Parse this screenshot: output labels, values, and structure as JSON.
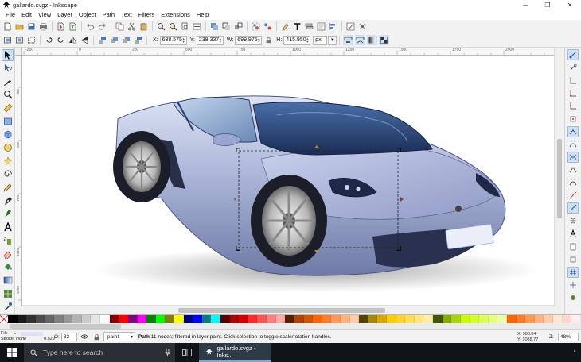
{
  "window": {
    "title": "gallardo.svgz - Inkscape"
  },
  "window_buttons": [
    "─",
    "❐",
    "✕"
  ],
  "menu": [
    "File",
    "Edit",
    "View",
    "Layer",
    "Object",
    "Path",
    "Text",
    "Filters",
    "Extensions",
    "Help"
  ],
  "select_toolbar": {
    "x_label": "X:",
    "x_value": "638.575",
    "y_label": "Y:",
    "y_value": "239.337",
    "w_label": "W:",
    "w_value": "699.975",
    "h_label": "H:",
    "h_value": "415.950",
    "unit": "px"
  },
  "ruler": {
    "h_labels": [
      "-250",
      "0",
      "250",
      "500",
      "750",
      "1000",
      "1250",
      "1500",
      "1750",
      "2000"
    ],
    "v_labels": [
      "250",
      "500",
      "750",
      "1000",
      "1250"
    ]
  },
  "status": {
    "fill_label": "Fill:",
    "fill_value": "L",
    "stroke_label": "Stroke:",
    "stroke_value": "None",
    "stroke_width": "0.529",
    "opacity_label": "O:",
    "opacity_value": "32",
    "layer": "-paint",
    "message_bold": "Path",
    "message_rest": " 11 nodes; filtered in layer paint. Click selection to toggle scale/rotation handles.",
    "x_coord": "X: 988.84",
    "y_coord": "Y: 1088.77",
    "zoom_label": "Z:",
    "zoom_value": "48%"
  },
  "taskbar": {
    "search_placeholder": "Type here to search",
    "active_app": "gallardo.svgz - Inks..."
  },
  "palette_colors": [
    "#000000",
    "#1a1a1a",
    "#333333",
    "#4d4d4d",
    "#666666",
    "#808080",
    "#999999",
    "#b3b3b3",
    "#cccccc",
    "#e6e6e6",
    "#ffffff",
    "#800000",
    "#ff0000",
    "#800080",
    "#ff00ff",
    "#008000",
    "#00ff00",
    "#808000",
    "#ffff00",
    "#000080",
    "#0000ff",
    "#008080",
    "#00ffff",
    "#550000",
    "#aa0000",
    "#d40000",
    "#ff2a2a",
    "#ff5555",
    "#ff8080",
    "#ffaaaa",
    "#552200",
    "#aa4400",
    "#d45500",
    "#ff6600",
    "#ff7f2a",
    "#ff9955",
    "#ffb380",
    "#ffccaa",
    "#554400",
    "#aa8800",
    "#d4aa00",
    "#ffcc00",
    "#ffd42a",
    "#ffdd55",
    "#ffe680",
    "#ffeeaa",
    "#445500",
    "#88aa00",
    "#aad400",
    "#ccff00",
    "#d4ff2a",
    "#ddff55",
    "#e5ff80",
    "#eeffaa",
    "#ff6600",
    "#ff7f2a",
    "#ff9955",
    "#ffb380",
    "#ffccaa",
    "#ffe6d5",
    "#ffd5d5",
    "#ffeeee"
  ]
}
